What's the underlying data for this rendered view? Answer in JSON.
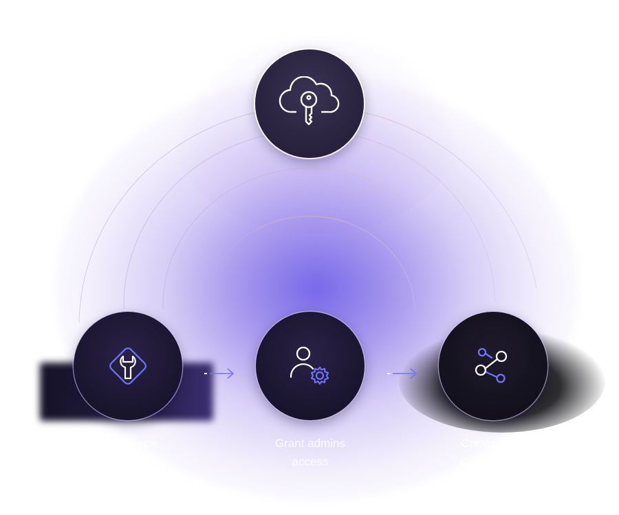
{
  "nodes": {
    "top": {
      "icon": "cloud-key-icon"
    },
    "left": {
      "icon": "wrench-diamond-icon",
      "label_line1": "Self-service",
      "label_line2": "profile"
    },
    "middle": {
      "icon": "user-gear-icon",
      "label_line1": "Grant admins",
      "label_line2": "access"
    },
    "right": {
      "icon": "share-nodes-icon",
      "label_line1": "Create SSO",
      "label_line2": "Connections"
    }
  },
  "colors": {
    "node_bg": "#1c1732",
    "icon_white": "#ffffff",
    "icon_accent": "#6f74ff",
    "arrow": "#6f74ff",
    "glow": "#7060e8"
  }
}
